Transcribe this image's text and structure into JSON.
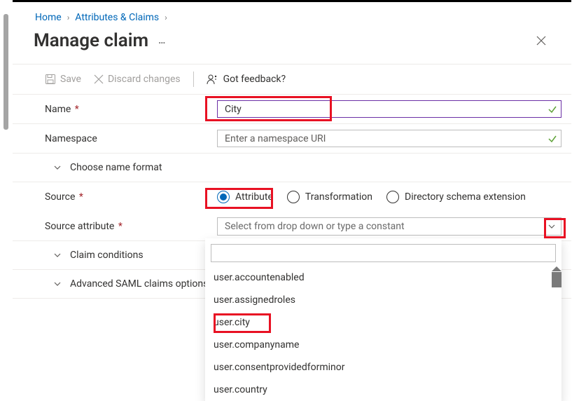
{
  "breadcrumbs": {
    "home": "Home",
    "attrclaims": "Attributes & Claims"
  },
  "page_title": "Manage claim",
  "toolbar": {
    "save": "Save",
    "discard": "Discard changes",
    "feedback": "Got feedback?"
  },
  "fields": {
    "name_label": "Name",
    "name_value": "City",
    "namespace_label": "Namespace",
    "namespace_placeholder": "Enter a namespace URI",
    "source_label": "Source",
    "source_attr_label": "Source attribute",
    "dropdown_placeholder": "Select from drop down or type a constant"
  },
  "collapsers": {
    "name_format": "Choose name format",
    "claim_conditions": "Claim conditions",
    "saml_options": "Advanced SAML claims options"
  },
  "radios": {
    "attribute": "Attribute",
    "transformation": "Transformation",
    "directory": "Directory schema extension"
  },
  "dropdown_items": [
    "user.accountenabled",
    "user.assignedroles",
    "user.city",
    "user.companyname",
    "user.consentprovidedforminor",
    "user.country"
  ],
  "colors": {
    "accent": "#0067b8",
    "highlight": "#e81123",
    "success": "#5ea237",
    "input_focus_border": "#6b2fa5"
  }
}
